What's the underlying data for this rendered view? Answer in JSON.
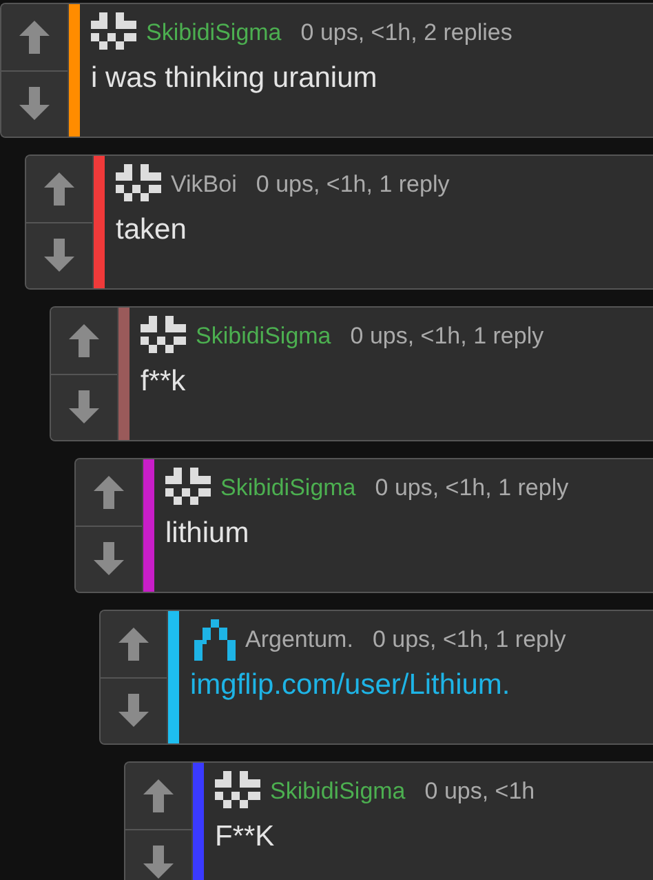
{
  "comment": {
    "username": "SkibidiSigma",
    "name_highlighted": true,
    "color": "#ff8c00",
    "avatar": {
      "kind": "blocks"
    },
    "meta": "0 ups, <1h, 2 replies",
    "body": {
      "kind": "text",
      "text": "i was thinking uranium"
    },
    "children": [
      {
        "username": "VikBoi",
        "name_highlighted": false,
        "color": "#f03a3a",
        "avatar": {
          "kind": "blocks"
        },
        "meta": "0 ups, <1h, 1 reply",
        "body": {
          "kind": "text",
          "text": "taken"
        },
        "children": [
          {
            "username": "SkibidiSigma",
            "name_highlighted": true,
            "color": "#9a5a5a",
            "avatar": {
              "kind": "blocks"
            },
            "meta": "0 ups, <1h, 1 reply",
            "body": {
              "kind": "text",
              "text": "f**k"
            },
            "children": [
              {
                "username": "SkibidiSigma",
                "name_highlighted": true,
                "color": "#c81ec8",
                "avatar": {
                  "kind": "blocks"
                },
                "meta": "0 ups, <1h, 1 reply",
                "body": {
                  "kind": "text",
                  "text": "lithium"
                },
                "children": [
                  {
                    "username": "Argentum.",
                    "name_highlighted": false,
                    "color": "#1ebef0",
                    "avatar": {
                      "kind": "arch"
                    },
                    "meta": "0 ups, <1h, 1 reply",
                    "body": {
                      "kind": "link",
                      "text": "imgflip.com/user/Lithium."
                    },
                    "children": [
                      {
                        "username": "SkibidiSigma",
                        "name_highlighted": true,
                        "color": "#3a3aff",
                        "avatar": {
                          "kind": "blocks"
                        },
                        "meta": "0 ups, <1h",
                        "body": {
                          "kind": "text",
                          "text": "F**K"
                        }
                      }
                    ]
                  }
                ]
              }
            ]
          }
        ]
      }
    ]
  }
}
